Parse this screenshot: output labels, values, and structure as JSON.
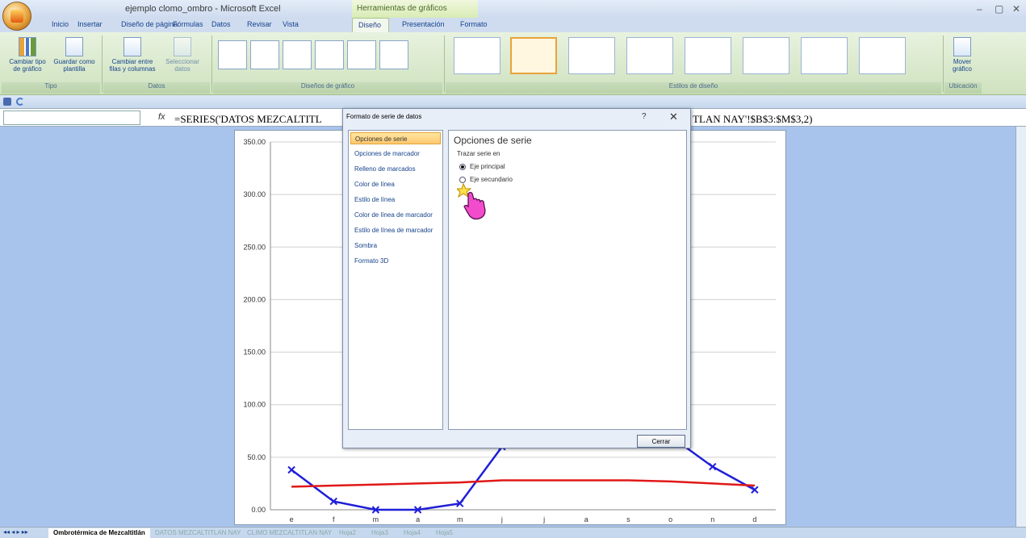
{
  "window": {
    "title": "ejemplo clomo_ombro - Microsoft Excel",
    "context_tab_title": "Herramientas de gráficos",
    "controls": [
      "–",
      "▢",
      "✕"
    ]
  },
  "tabs": [
    "Inicio",
    "Insertar",
    "Diseño de página",
    "Fórmulas",
    "Datos",
    "Revisar",
    "Vista",
    "Diseño",
    "Presentación",
    "Formato"
  ],
  "ribbon": {
    "buttons": [
      "Cambiar tipo de gráfico",
      "Guardar como plantilla",
      "Cambiar entre filas y columnas",
      "Seleccionar datos",
      "Mover gráfico"
    ],
    "groups": [
      "Tipo",
      "Datos",
      "Diseños de gráfico",
      "Estilos de diseño",
      "Ubicación"
    ]
  },
  "formula_bar": {
    "fx": "fx",
    "formula_left": "=SERIES('DATOS MEZCALTITL",
    "formula_right": "TLAN NAY'!$B$3:$M$3,2)"
  },
  "dialog": {
    "title": "Formato de serie de datos",
    "help": "?",
    "close": "✕",
    "nav": [
      "Opciones de serie",
      "Opciones de marcador",
      "Relleno de marcados",
      "Color de línea",
      "Estilo de línea",
      "Color de línea de marcador",
      "Estilo de línea de marcador",
      "Sombra",
      "Formato 3D"
    ],
    "selected_nav": 0,
    "panel_title": "Opciones de serie",
    "panel_subtitle": "Trazar serie en",
    "radios": [
      {
        "label": "Eje principal",
        "checked": true
      },
      {
        "label": "Eje secundario",
        "checked": false
      }
    ],
    "close_button": "Cerrar"
  },
  "chart_data": {
    "type": "line",
    "categories": [
      "e",
      "f",
      "m",
      "a",
      "m",
      "j",
      "j",
      "a",
      "s",
      "o",
      "n",
      "d"
    ],
    "y_tick_labels": [
      "350.00",
      "300.00",
      "250.00",
      "200.00",
      "150.00",
      "100.00",
      "50.00",
      "0.00"
    ],
    "ylim": [
      0,
      350
    ],
    "grid": true,
    "series": [
      {
        "values": [
          38,
          8,
          0,
          0,
          6,
          60,
          null,
          null,
          null,
          70,
          41,
          19
        ],
        "color": "#1f1fd8"
      },
      {
        "values": [
          22,
          23,
          24,
          25,
          26,
          28,
          28,
          28,
          28,
          27,
          25,
          23
        ],
        "color": "#e01818"
      }
    ]
  },
  "sheet_tabs": [
    "Ombrotérmica de Mezcaltitlán",
    "DATOS MEZCALTITLAN NAY",
    "CLIMO MEZCALTITLAN NAY",
    "Hoja2",
    "Hoja3",
    "Hoja4",
    "Hoja5"
  ],
  "active_sheet": 0,
  "colors": {
    "ribbon": "#dcead0",
    "sheet_bg": "#a9c4ec",
    "accent": "#e8a33a"
  }
}
